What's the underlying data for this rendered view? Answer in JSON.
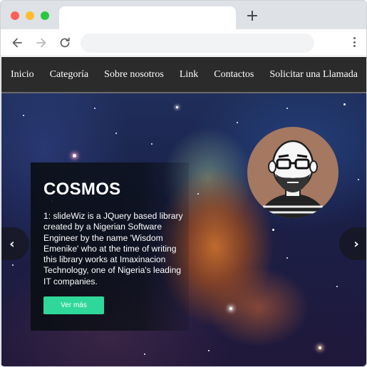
{
  "browser": {
    "tab_title": "",
    "address_placeholder": "",
    "new_tab_symbol": "+"
  },
  "nav": {
    "items": [
      "Inicio",
      "Categoría",
      "Sobre nosotros",
      "Link",
      "Contactos",
      "Solicitar una Llamada"
    ]
  },
  "slide": {
    "title": "COSMOS",
    "text": "1: slideWiz is a JQuery based library created by a Nigerian Software Engineer by the name 'Wisdom Emenike' who at the time of writing this library works at Imaxinacion Technology, one of Nigeria's leading IT companies.",
    "button_label": "Ver más"
  },
  "controls": {
    "prev_symbol": "‹",
    "next_symbol": "›"
  },
  "colors": {
    "nav_bg": "#2b2b2b",
    "cta": "#2fd89a",
    "avatar_bg": "#a57862"
  },
  "icons": [
    "back-arrow-icon",
    "forward-arrow-icon",
    "reload-icon",
    "more-vert-icon",
    "avatar-illustration"
  ]
}
